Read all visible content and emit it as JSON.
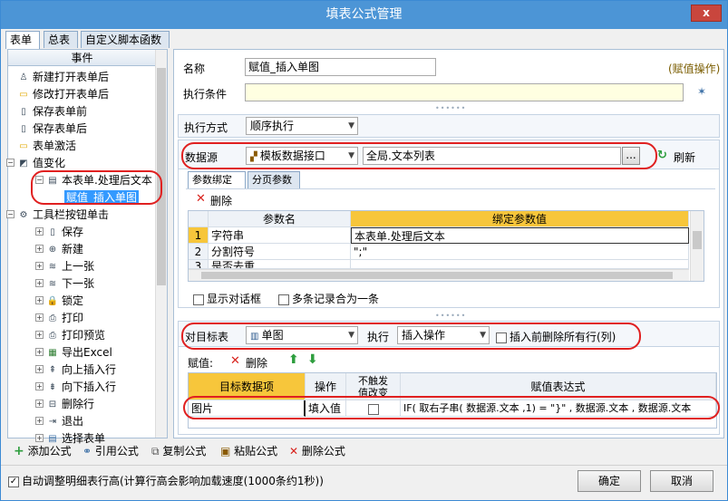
{
  "window": {
    "title": "填表公式管理",
    "close": "x"
  },
  "tabs": [
    "表单",
    "总表",
    "自定义脚本函数"
  ],
  "tree": {
    "header": "事件",
    "items": [
      {
        "label": "新建打开表单后",
        "icon": "doc-user-icon",
        "level": 1
      },
      {
        "label": "修改打开表单后",
        "icon": "folder-open-icon",
        "level": 1
      },
      {
        "label": "保存表单前",
        "icon": "doc-edit-icon",
        "level": 1
      },
      {
        "label": "保存表单后",
        "icon": "doc-save-icon",
        "level": 1
      },
      {
        "label": "表单激活",
        "icon": "folder-icon",
        "level": 1
      },
      {
        "label": "值变化",
        "icon": "value-change-icon",
        "level": 1
      },
      {
        "label": "本表单.处理后文本",
        "icon": "form-icon",
        "level": 2
      },
      {
        "label": "赋值_插入单图",
        "icon": "",
        "level": 3
      },
      {
        "label": "工具栏按钮单击",
        "icon": "tool-icon",
        "level": 1
      },
      {
        "label": "保存",
        "icon": "save-icon",
        "level": 2
      },
      {
        "label": "新建",
        "icon": "new-icon",
        "level": 2
      },
      {
        "label": "上一张",
        "icon": "prev-icon",
        "level": 2
      },
      {
        "label": "下一张",
        "icon": "next-icon",
        "level": 2
      },
      {
        "label": "锁定",
        "icon": "lock-icon",
        "level": 2
      },
      {
        "label": "打印",
        "icon": "print-icon",
        "level": 2
      },
      {
        "label": "打印预览",
        "icon": "print-preview-icon",
        "level": 2
      },
      {
        "label": "导出Excel",
        "icon": "excel-icon",
        "level": 2
      },
      {
        "label": "向上插入行",
        "icon": "insert-up-icon",
        "level": 2
      },
      {
        "label": "向下插入行",
        "icon": "insert-down-icon",
        "level": 2
      },
      {
        "label": "删除行",
        "icon": "delete-row-icon",
        "level": 2
      },
      {
        "label": "退出",
        "icon": "exit-icon",
        "level": 2
      },
      {
        "label": "选择表单",
        "icon": "select-icon",
        "level": 2
      }
    ]
  },
  "form": {
    "name_label": "名称",
    "name_value": "赋值_插入单图",
    "kind_tag": "(赋值操作)",
    "cond_label": "执行条件",
    "cond_value": "",
    "mode_label": "执行方式",
    "mode_value": "顺序执行"
  },
  "datasource": {
    "label": "数据源",
    "type_value": "模板数据接口",
    "source_value": "全局.文本列表",
    "browse": "...",
    "refresh": "刷新",
    "subtabs": [
      "参数绑定",
      "分页参数"
    ],
    "delete": "删除",
    "grid_headers": [
      "参数名",
      "绑定参数值"
    ],
    "rows": [
      {
        "num": "1",
        "name": "字符串",
        "value": "本表单.处理后文本"
      },
      {
        "num": "2",
        "name": "分割符号",
        "value": "\";\""
      },
      {
        "num": "3",
        "name": "是否去重",
        "value": ""
      }
    ],
    "show_dialog": "显示对话框",
    "merge_records": "多条记录合为一条"
  },
  "target": {
    "label": "对目标表",
    "table_value": "单图",
    "exec_label": "执行",
    "exec_value": "插入操作",
    "delete_all": "插入前删除所有行(列)",
    "assign_label": "赋值:",
    "delete": "删除",
    "grid_headers": [
      "目标数据项",
      "操作",
      "不触发值改变",
      "赋值表达式"
    ],
    "rows": [
      {
        "item": "图片",
        "op": "填入值",
        "no_trigger": false,
        "expr": "IF( 取右子串( 数据源.文本 ,1) = \"}\" , 数据源.文本 , 数据源.文本"
      }
    ]
  },
  "bottom": {
    "add": "添加公式",
    "ref": "引用公式",
    "copy": "复制公式",
    "paste": "粘贴公式",
    "delete": "删除公式",
    "auto_row": "自动调整明细表行高(计算行高会影响加载速度(1000条约1秒))",
    "ok": "确定",
    "cancel": "取消"
  },
  "colors": {
    "title_bg": "#4c95d6",
    "accent": "#f7c63b",
    "highlight": "#3399ff",
    "oval": "#e02020",
    "green": "#2e9e3e"
  }
}
